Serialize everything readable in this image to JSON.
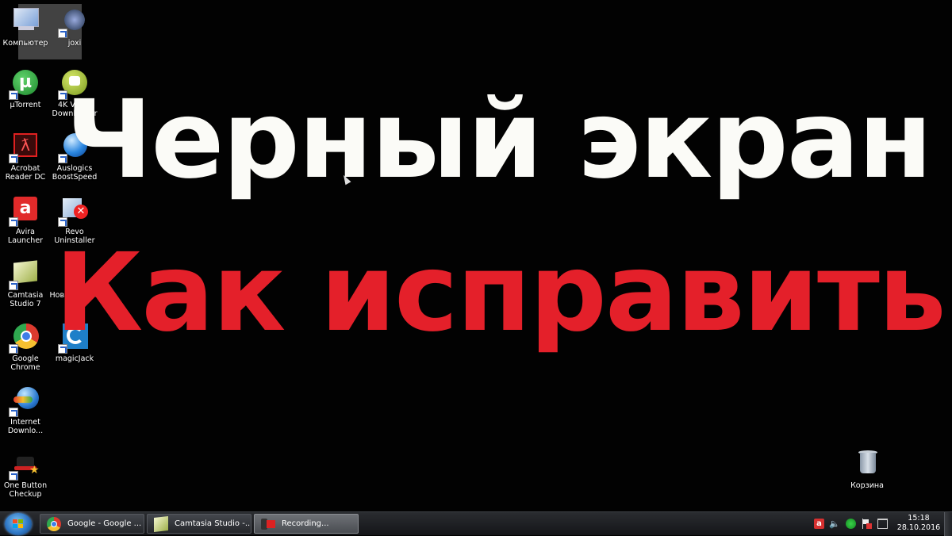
{
  "headline": {
    "line1": "Черный экран",
    "line2": "Как исправить",
    "line1_color": "#fbfbf7",
    "line2_color": "#e4202a"
  },
  "desktop_icons": [
    {
      "label": "Компьютер",
      "icon": "computer-icon"
    },
    {
      "label": "joxi",
      "icon": "joxi-icon"
    },
    {
      "label": "µTorrent",
      "icon": "utorrent-icon"
    },
    {
      "label": "4K Video Downloader",
      "icon": "4k-video-downloader-icon"
    },
    {
      "label": "Acrobat Reader DC",
      "icon": "acrobat-reader-icon"
    },
    {
      "label": "Auslogics BoostSpeed",
      "icon": "auslogics-icon"
    },
    {
      "label": "Avira Launcher",
      "icon": "avira-icon"
    },
    {
      "label": "Revo Uninstaller",
      "icon": "revo-uninstaller-icon"
    },
    {
      "label": "Camtasia Studio 7",
      "icon": "camtasia-icon"
    },
    {
      "label": "Новая папка",
      "icon": "folder-icon"
    },
    {
      "label": "Google Chrome",
      "icon": "chrome-icon"
    },
    {
      "label": "magicJack",
      "icon": "magicjack-icon"
    },
    {
      "label": "Internet Downlo...",
      "icon": "internet-download-manager-icon"
    },
    {
      "label": "One Button Checkup",
      "icon": "one-button-checkup-icon"
    },
    {
      "label": "Корзина",
      "icon": "recycle-bin-icon"
    }
  ],
  "taskbar": {
    "start_icon": "windows-start-icon",
    "buttons": [
      {
        "label": "Google - Google ...",
        "icon": "chrome-icon"
      },
      {
        "label": "Camtasia Studio -...",
        "icon": "camtasia-icon"
      },
      {
        "label": "Recording...",
        "icon": "recording-icon",
        "active": true
      }
    ],
    "tray_icons": [
      "avira-tray-icon",
      "volume-icon",
      "network-green-icon",
      "action-center-flag-icon",
      "display-icon"
    ],
    "clock_time": "15:18",
    "clock_date": "28.10.2016"
  }
}
